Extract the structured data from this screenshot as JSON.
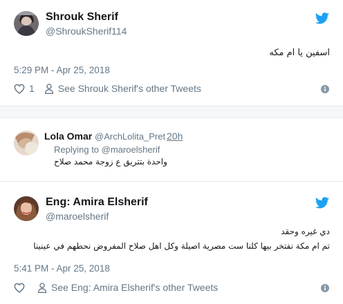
{
  "tweets": [
    {
      "name": "Shrouk Sherif",
      "handle": "@ShroukSherif114",
      "text": "اسفين يا ام مكه",
      "timestamp": "5:29 PM - Apr 25, 2018",
      "like_count": "1",
      "other_tweets": "See Shrouk Sherif's other Tweets"
    },
    {
      "name": "Eng: Amira Elsherif",
      "handle": "@maroelsherif",
      "text_line1": "دي غيره وحقد",
      "text_line2": "تم ام مكة نفتخر بيها كلنا  ست مصرية اصيلة وكل اهل صلاح المفروض نحطهم في عينينا",
      "timestamp": "5:41 PM - Apr 25, 2018",
      "other_tweets": "See Eng: Amira Elsherif's other Tweets"
    }
  ],
  "reply": {
    "name": "Lola Omar",
    "handle": "@ArchLolita_Pret",
    "time": "20h",
    "replying_to": "Replying to @maroelsherif",
    "text": "واحدة بتتريق ع زوجة محمد صلاح"
  },
  "icons": {
    "bird": "twitter-bird-icon",
    "heart": "heart-icon",
    "person": "person-icon",
    "info": "info-icon"
  },
  "colors": {
    "brand_blue": "#1da1f2",
    "text": "#14171a",
    "secondary": "#657786",
    "divider": "#e1e8ed",
    "gap_bg": "#f5f8fa"
  }
}
